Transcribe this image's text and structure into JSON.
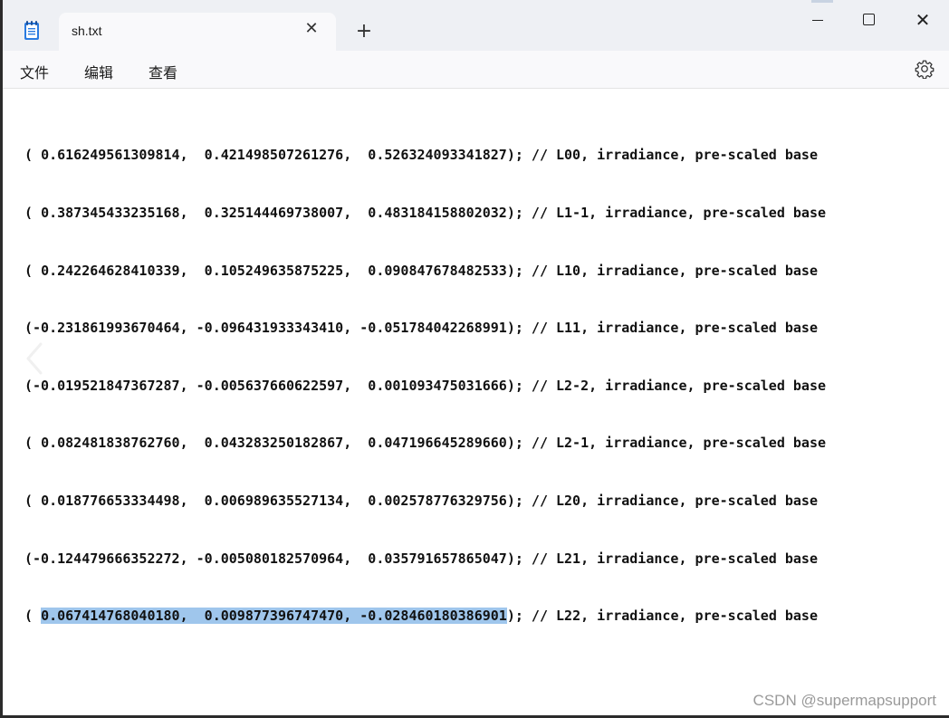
{
  "window": {
    "tab_title": "sh.txt",
    "new_tab_symbol": "+",
    "tab_close_symbol": "✕",
    "close_symbol": "✕"
  },
  "menu": {
    "file": "文件",
    "edit": "编辑",
    "view": "查看"
  },
  "icons": {
    "app": "notepad-icon",
    "settings": "gear-icon",
    "back": "chevron-left-icon"
  },
  "colors": {
    "selection": "#9fc6ec",
    "titlebar": "#eef0f4",
    "tab": "#f9f9fb",
    "app_icon_accent": "#1f6fd1"
  },
  "lines": [
    {
      "prefix": "( ",
      "selected": "",
      "suffix": "0.616249561309814,  0.421498507261276,  0.526324093341827); // L00, irradiance, pre-scaled base"
    },
    {
      "prefix": "( ",
      "selected": "",
      "suffix": "0.387345433235168,  0.325144469738007,  0.483184158802032); // L1-1, irradiance, pre-scaled base"
    },
    {
      "prefix": "( ",
      "selected": "",
      "suffix": "0.242264628410339,  0.105249635875225,  0.090847678482533); // L10, irradiance, pre-scaled base"
    },
    {
      "prefix": "(",
      "selected": "",
      "suffix": "-0.231861993670464, -0.096431933343410, -0.051784042268991); // L11, irradiance, pre-scaled base"
    },
    {
      "prefix": "(",
      "selected": "",
      "suffix": "-0.019521847367287, -0.005637660622597,  0.001093475031666); // L2-2, irradiance, pre-scaled base"
    },
    {
      "prefix": "( ",
      "selected": "",
      "suffix": "0.082481838762760,  0.043283250182867,  0.047196645289660); // L2-1, irradiance, pre-scaled base"
    },
    {
      "prefix": "( ",
      "selected": "",
      "suffix": "0.018776653334498,  0.006989635527134,  0.002578776329756); // L20, irradiance, pre-scaled base"
    },
    {
      "prefix": "(",
      "selected": "",
      "suffix": "-0.124479666352272, -0.005080182570964,  0.035791657865047); // L21, irradiance, pre-scaled base"
    },
    {
      "prefix": "( ",
      "selected": "0.067414768040180,  0.009877396747470, -0.028460180386901",
      "suffix": "); // L22, irradiance, pre-scaled base"
    }
  ],
  "watermark": "CSDN @supermapsupport"
}
